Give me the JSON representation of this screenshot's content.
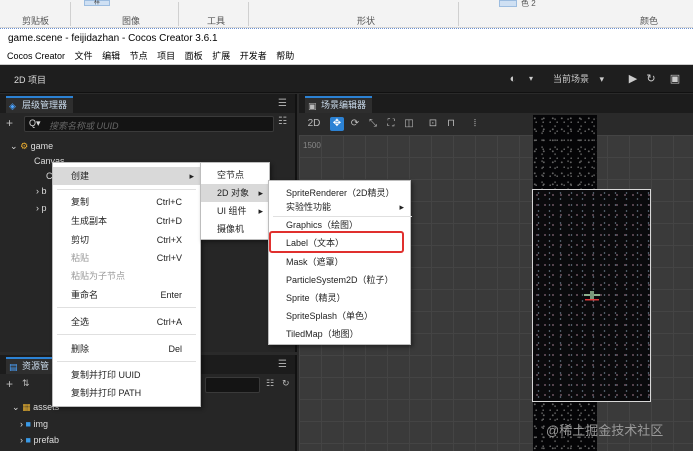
{
  "ribbon": {
    "groups": [
      "剪贴板",
      "图像",
      "工具",
      "形状",
      "颜色"
    ],
    "format_btn": "样",
    "color_label": "色 2"
  },
  "window": {
    "title": "game.scene - feijidazhan - Cocos Creator 3.6.1"
  },
  "menubar": [
    "Cocos Creator",
    "文件",
    "编辑",
    "节点",
    "项目",
    "面板",
    "扩展",
    "开发者",
    "帮助"
  ],
  "toolbar": {
    "project": "2D 项目",
    "scene_select": "当前场景"
  },
  "hierarchy": {
    "tab": "层级管理器",
    "search_placeholder": "搜索名称或 UUID",
    "tree": [
      {
        "label": "game"
      },
      {
        "label": "Canvas"
      },
      {
        "label": "C"
      },
      {
        "label": "b"
      },
      {
        "label": "p"
      }
    ]
  },
  "assets": {
    "tab": "资源管",
    "tree": [
      {
        "label": "assets"
      },
      {
        "label": "img"
      },
      {
        "label": "prefab"
      }
    ]
  },
  "scene": {
    "tab": "场景编辑器",
    "mode": "2D",
    "ruler": "1500",
    "watermark": "@稀土掘金技术社区"
  },
  "context_menu": {
    "items": [
      {
        "label": "创建",
        "shortcut": ""
      },
      {
        "label": "复制",
        "shortcut": "Ctrl+C"
      },
      {
        "label": "生成副本",
        "shortcut": "Ctrl+D"
      },
      {
        "label": "剪切",
        "shortcut": "Ctrl+X"
      },
      {
        "label": "粘贴",
        "shortcut": "Ctrl+V"
      },
      {
        "label": "粘贴为子节点",
        "shortcut": ""
      },
      {
        "label": "重命名",
        "shortcut": "Enter"
      },
      {
        "label": "全选",
        "shortcut": "Ctrl+A"
      },
      {
        "label": "删除",
        "shortcut": "Del"
      },
      {
        "label": "复制并打印 UUID",
        "shortcut": ""
      },
      {
        "label": "复制并打印 PATH",
        "shortcut": ""
      }
    ]
  },
  "create_submenu": [
    "空节点",
    "2D 对象",
    "UI 组件",
    "摄像机"
  ],
  "obj2d_submenu": [
    "SpriteRenderer（2D精灵）",
    "实验性功能",
    "Graphics（绘图）",
    "Label（文本）",
    "Mask（遮罩）",
    "ParticleSystem2D（粒子）",
    "Sprite（精灵）",
    "SpriteSplash（单色）",
    "TiledMap（地图）"
  ],
  "colors": {
    "accent": "#2c82d4",
    "highlight": "#e0302e"
  }
}
